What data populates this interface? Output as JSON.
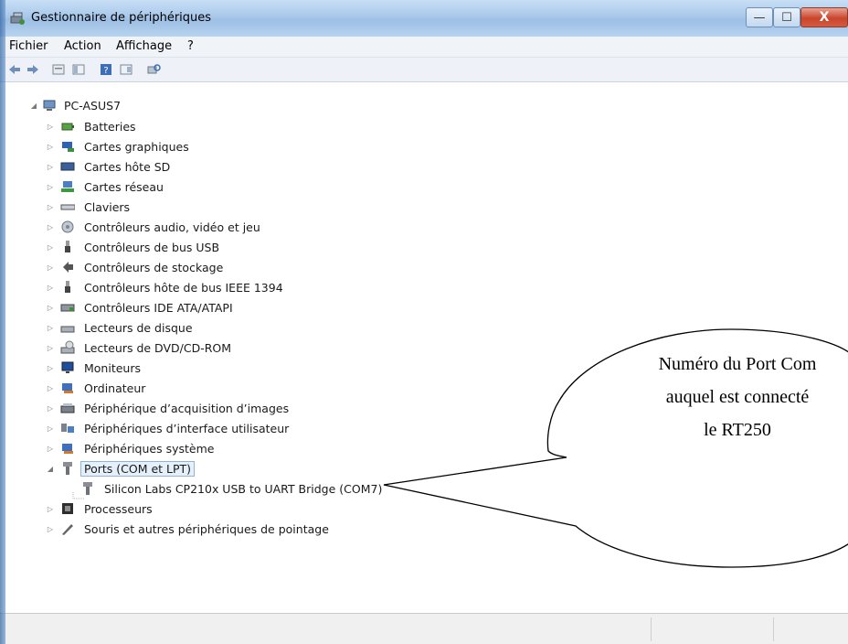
{
  "window": {
    "title": "Gestionnaire de périphériques",
    "buttons": {
      "minimize": "—",
      "maximize": "☐",
      "close": "X"
    }
  },
  "menu": [
    "Fichier",
    "Action",
    "Affichage",
    "?"
  ],
  "toolbar_icons": [
    "back-icon",
    "forward-icon",
    "properties-icon",
    "show-hide-tree-icon",
    "help-icon",
    "console-tree-icon",
    "scan-hardware-icon"
  ],
  "tree": {
    "root": "PC-ASUS7",
    "items": [
      "Batteries",
      "Cartes graphiques",
      "Cartes hôte SD",
      "Cartes réseau",
      "Claviers",
      "Contrôleurs audio, vidéo et jeu",
      "Contrôleurs de bus USB",
      "Contrôleurs de stockage",
      "Contrôleurs hôte de bus IEEE 1394",
      "Contrôleurs IDE ATA/ATAPI",
      "Lecteurs de disque",
      "Lecteurs de DVD/CD-ROM",
      "Moniteurs",
      "Ordinateur",
      "Périphérique d’acquisition d’images",
      "Périphériques d’interface utilisateur",
      "Périphériques système",
      "Ports (COM et LPT)",
      "Silicon Labs CP210x USB to UART Bridge (COM7)",
      "Processeurs",
      "Souris et autres périphériques de pointage"
    ]
  },
  "callout": {
    "line1": "Numéro du Port Com",
    "line2": "auquel est connecté",
    "line3": "le RT250"
  },
  "colors": {
    "selection": "#e5f0fb",
    "selection_border": "#8fb3de",
    "titlebar": "#a8c8ea",
    "close": "#c9452c"
  }
}
